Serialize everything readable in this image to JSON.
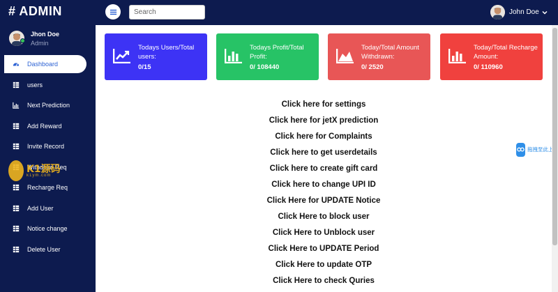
{
  "topbar": {
    "brand": "# ADMIN",
    "search_placeholder": "Search",
    "user_name": "John Doe"
  },
  "sidebar": {
    "profile_name": "Jhon Doe",
    "profile_role": "Admin",
    "items": [
      {
        "label": "Dashboard",
        "icon": "dashboard-icon",
        "active": true
      },
      {
        "label": "users",
        "icon": "table-icon"
      },
      {
        "label": "Next Prediction",
        "icon": "bar-chart-icon"
      },
      {
        "label": "Add Reward",
        "icon": "table-icon"
      },
      {
        "label": "Invite Record",
        "icon": "table-icon"
      },
      {
        "label": "Withdraw Req",
        "icon": "table-icon"
      },
      {
        "label": "Recharge Req",
        "icon": "table-icon"
      },
      {
        "label": "Add User",
        "icon": "table-icon"
      },
      {
        "label": "Notice change",
        "icon": "table-icon"
      },
      {
        "label": "Delete User",
        "icon": "table-icon"
      }
    ]
  },
  "watermark": {
    "text": "K1源码",
    "sub": "k1ym.com"
  },
  "cards": [
    {
      "title": "Todays Users/Total users:",
      "value": "0/15",
      "color": "#3d33f5",
      "icon": "line-chart-icon"
    },
    {
      "title": "Todays Profit/Total Profit:",
      "value": "0/ 108440",
      "color": "#27c366",
      "icon": "bar-chart-icon"
    },
    {
      "title": "Today/Total Amount Withdrawn:",
      "value": "0/ 2520",
      "color": "#e85656",
      "icon": "area-chart-icon"
    },
    {
      "title": "Today/Total Recharge Amount:",
      "value": "0/ 110960",
      "color": "#f0413e",
      "icon": "bar-chart-icon"
    }
  ],
  "links": [
    "Click here for settings",
    "Click here for jetX prediction",
    "Click here for Complaints",
    "Click here to get userdetails",
    "Click here to create gift card",
    "Click here to change UPI ID",
    "Click Here for UPDATE Notice",
    "Click Here to block user",
    "Click Here to Unblock user",
    "Click Here to UPDATE Period",
    "Click Here to update OTP",
    "Click Here to check Quries"
  ],
  "float_widget": {
    "text": "拖拽至此上传"
  },
  "colors": {
    "navy": "#0d1b4f",
    "active_text": "#2e63d4"
  }
}
